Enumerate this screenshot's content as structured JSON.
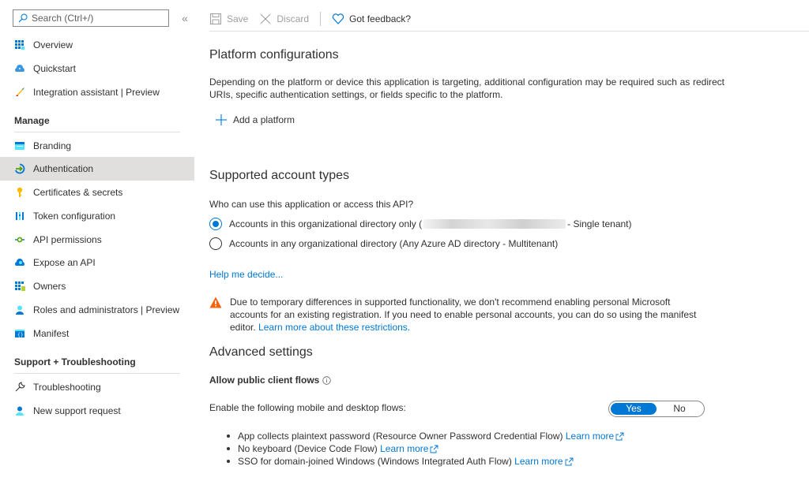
{
  "sidebar": {
    "search_placeholder": "Search (Ctrl+/)",
    "collapse_glyph": "«",
    "top_items": [
      {
        "label": "Overview",
        "icon": "overview-grid-icon"
      },
      {
        "label": "Quickstart",
        "icon": "quickstart-cloud-icon"
      },
      {
        "label": "Integration assistant | Preview",
        "icon": "rocket-icon"
      }
    ],
    "sections": [
      {
        "title": "Manage",
        "items": [
          {
            "label": "Branding",
            "icon": "branding-icon"
          },
          {
            "label": "Authentication",
            "icon": "authentication-icon",
            "active": true
          },
          {
            "label": "Certificates & secrets",
            "icon": "key-icon"
          },
          {
            "label": "Token configuration",
            "icon": "token-bars-icon"
          },
          {
            "label": "API permissions",
            "icon": "api-permissions-icon"
          },
          {
            "label": "Expose an API",
            "icon": "cloud-icon"
          },
          {
            "label": "Owners",
            "icon": "owners-icon"
          },
          {
            "label": "Roles and administrators | Preview",
            "icon": "roles-user-icon"
          },
          {
            "label": "Manifest",
            "icon": "manifest-icon"
          }
        ]
      },
      {
        "title": "Support + Troubleshooting",
        "items": [
          {
            "label": "Troubleshooting",
            "icon": "wrench-icon"
          },
          {
            "label": "New support request",
            "icon": "support-user-icon"
          }
        ]
      }
    ]
  },
  "toolbar": {
    "save_label": "Save",
    "discard_label": "Discard",
    "feedback_label": "Got feedback?"
  },
  "platform": {
    "title": "Platform configurations",
    "description": "Depending on the platform or device this application is targeting, additional configuration may be required such as redirect URIs, specific authentication settings, or fields specific to the platform.",
    "add_label": "Add a platform"
  },
  "accounts": {
    "title": "Supported account types",
    "question": "Who can use this application or access this API?",
    "options": [
      {
        "prefix": "Accounts in this organizational directory only (",
        "suffix": " - Single tenant)",
        "checked": true,
        "redacted": true
      },
      {
        "prefix": "Accounts in any organizational directory (Any Azure AD directory - Multitenant)",
        "suffix": "",
        "checked": false,
        "redacted": false
      }
    ],
    "help_link": "Help me decide...",
    "warning_text": "Due to temporary differences in supported functionality, we don't recommend enabling personal Microsoft accounts for an existing registration. If you need to enable personal accounts, you can do so using the manifest editor. ",
    "warning_link": "Learn more about these restrictions."
  },
  "advanced": {
    "title": "Advanced settings",
    "subhead": "Allow public client flows",
    "enable_label": "Enable the following mobile and desktop flows:",
    "toggle": {
      "yes": "Yes",
      "no": "No",
      "selected": "Yes"
    },
    "flows": [
      {
        "text": "App collects plaintext password (Resource Owner Password Credential Flow) ",
        "link": "Learn more"
      },
      {
        "text": "No keyboard (Device Code Flow) ",
        "link": "Learn more"
      },
      {
        "text": "SSO for domain-joined Windows (Windows Integrated Auth Flow) ",
        "link": "Learn more"
      }
    ]
  },
  "colors": {
    "accent": "#0078d4",
    "active_nav_bg": "#e1dfdd",
    "warning": "#f7630c"
  }
}
